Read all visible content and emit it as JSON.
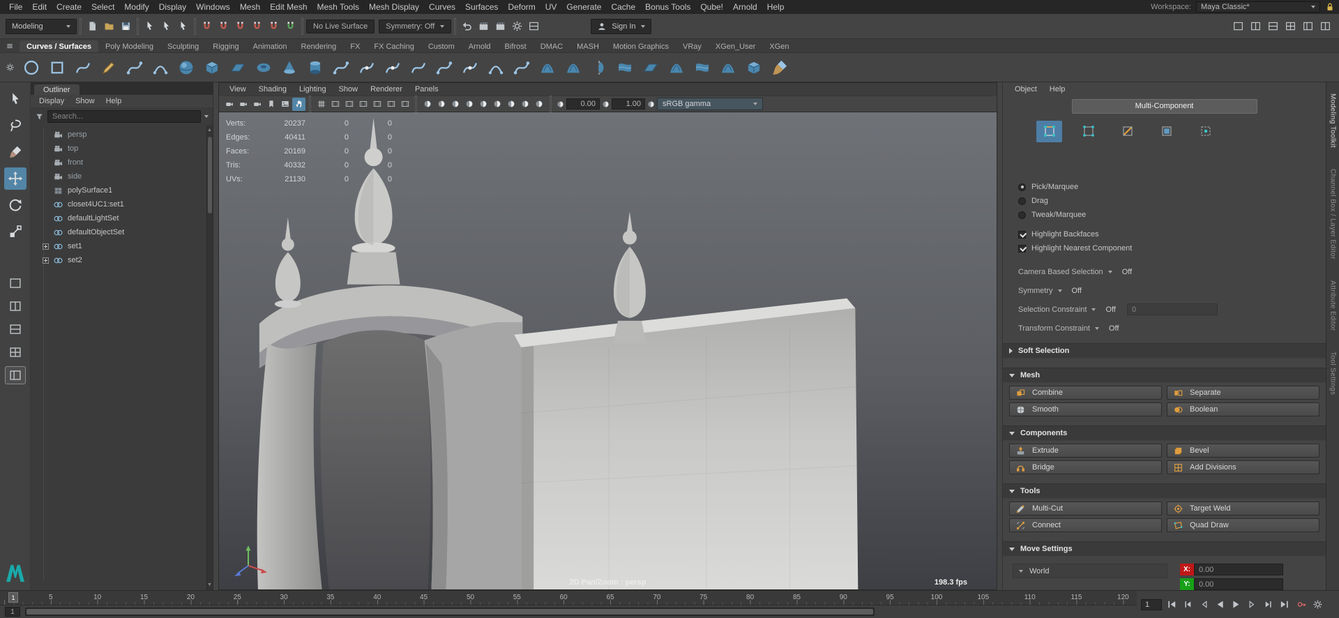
{
  "app": {
    "accent_color": "#5285a6",
    "background": "#444444"
  },
  "menubar": {
    "items": [
      "File",
      "Edit",
      "Create",
      "Select",
      "Modify",
      "Display",
      "Windows",
      "Mesh",
      "Edit Mesh",
      "Mesh Tools",
      "Mesh Display",
      "Curves",
      "Surfaces",
      "Deform",
      "UV",
      "Generate",
      "Cache",
      "Bonus Tools",
      "Qube!",
      "Arnold",
      "Help"
    ],
    "workspace_label": "Workspace:",
    "workspace_value": "Maya Classic*"
  },
  "status_line": {
    "mode_selector": "Modeling",
    "live_surface": "No Live Surface",
    "symmetry": "Symmetry: Off",
    "sign_in": "Sign In",
    "file_icons": [
      "new-scene-icon",
      "open-scene-icon",
      "save-scene-icon"
    ],
    "selection_icons": [
      "select-hierarchy-icon",
      "select-object-icon",
      "select-component-icon"
    ],
    "snap_icons": [
      "snap-grid-icon",
      "snap-curve-icon",
      "snap-point-icon",
      "snap-projected-center-icon",
      "snap-view-plane-icon",
      "make-live-icon"
    ],
    "render_icons": [
      "construction-history-icon",
      "render-frame-icon",
      "ipr-render-icon",
      "render-settings-icon",
      "display-layers-icon"
    ],
    "layout_icons": [
      "single-pane-icon",
      "two-pane-icon",
      "stacked-pane-icon",
      "four-pane-icon",
      "outliner-pane-icon",
      "script-editor-pane-icon"
    ]
  },
  "shelf": {
    "active_tab": "Curves / Surfaces",
    "tabs": [
      "Curves / Surfaces",
      "Poly Modeling",
      "Sculpting",
      "Rigging",
      "Animation",
      "Rendering",
      "FX",
      "FX Caching",
      "Custom",
      "Arnold",
      "Bifrost",
      "DMAC",
      "MASH",
      "Motion Graphics",
      "VRay",
      "XGen_User",
      "XGen"
    ],
    "icons": [
      "nurbs-circle-icon",
      "nurbs-square-icon",
      "ep-curve-tool-icon",
      "pencil-curve-tool-icon",
      "bezier-curve-tool-icon",
      "three-point-arc-icon",
      "nurbs-sphere-icon",
      "nurbs-cube-icon",
      "nurbs-plane-icon",
      "nurbs-torus-icon",
      "nurbs-cone-icon",
      "nurbs-cylinder-icon",
      "attach-curves-icon",
      "detach-curves-icon",
      "insert-knot-icon",
      "extend-curve-icon",
      "offset-curve-icon",
      "rebuild-curve-icon",
      "curve-fillet-icon",
      "intersect-curves-icon",
      "project-curve-icon",
      "trim-tool-icon",
      "revolve-icon",
      "loft-icon",
      "planar-icon",
      "extrude-surface-icon",
      "birail-icon",
      "boundary-icon",
      "nurbs-to-polygons-icon",
      "paint-effects-brush-icon"
    ]
  },
  "toolbox": {
    "tools": [
      {
        "label": "Select Tool",
        "icon": "select-cursor-icon",
        "active": false
      },
      {
        "label": "Lasso Tool",
        "icon": "lasso-icon",
        "active": false
      },
      {
        "label": "Paint Selection Tool",
        "icon": "paint-select-icon",
        "active": false
      },
      {
        "label": "Move Tool",
        "icon": "move-tool-icon",
        "active": true
      },
      {
        "label": "Rotate Tool",
        "icon": "rotate-tool-icon",
        "active": false
      },
      {
        "label": "Scale Tool",
        "icon": "scale-tool-icon",
        "active": false
      }
    ],
    "layouts": [
      {
        "icon": "single-pane-layout-icon",
        "active": false
      },
      {
        "icon": "two-pane-layout-icon",
        "active": false
      },
      {
        "icon": "stacked-pane-layout-icon",
        "active": false
      },
      {
        "icon": "four-pane-layout-icon",
        "active": false
      },
      {
        "icon": "outliner-persp-layout-icon",
        "active": true
      }
    ]
  },
  "outliner": {
    "title": "Outliner",
    "menus": [
      "Display",
      "Show",
      "Help"
    ],
    "search_placeholder": "Search...",
    "items": [
      {
        "label": "persp",
        "icon": "camera-icon",
        "dim": true,
        "expandable": false
      },
      {
        "label": "top",
        "icon": "camera-icon",
        "dim": true,
        "expandable": false
      },
      {
        "label": "front",
        "icon": "camera-icon",
        "dim": true,
        "expandable": false
      },
      {
        "label": "side",
        "icon": "camera-icon",
        "dim": true,
        "expandable": false
      },
      {
        "label": "polySurface1",
        "icon": "poly-mesh-icon",
        "dim": false,
        "expandable": false
      },
      {
        "label": "closet4UC1:set1",
        "icon": "object-set-icon",
        "dim": false,
        "expandable": false
      },
      {
        "label": "defaultLightSet",
        "icon": "light-set-icon",
        "dim": false,
        "expandable": false
      },
      {
        "label": "defaultObjectSet",
        "icon": "object-set-icon",
        "dim": false,
        "expandable": false
      },
      {
        "label": "set1",
        "icon": "object-set-icon",
        "dim": false,
        "expandable": true
      },
      {
        "label": "set2",
        "icon": "object-set-icon",
        "dim": false,
        "expandable": true
      }
    ]
  },
  "viewport": {
    "menus": [
      "View",
      "Shading",
      "Lighting",
      "Show",
      "Renderer",
      "Panels"
    ],
    "toolbar": {
      "groups": [
        [
          "select-camera-icon",
          "lock-camera-icon",
          "camera-attributes-icon",
          "bookmark-icon",
          "image-plane-icon",
          "2d-pan-zoom-icon"
        ],
        [
          "grid-toggle-icon",
          "film-gate-icon",
          "resolution-gate-icon",
          "gate-mask-icon",
          "field-chart-icon",
          "safe-action-icon",
          "safe-title-icon"
        ],
        [
          "wireframe-icon",
          "smooth-shade-icon",
          "textured-icon",
          "use-default-material-icon",
          "shadows-icon",
          "screen-space-ao-icon",
          "motion-blur-icon",
          "multisample-icon",
          "isolate-select-icon"
        ]
      ],
      "active_icon": "2d-pan-zoom-icon",
      "exposure_value": "0.00",
      "gamma_value": "1.00",
      "color_transform": "sRGB gamma"
    },
    "hud": {
      "rows": [
        {
          "label": "Verts:",
          "total": "20237",
          "sel": "0",
          "other": "0"
        },
        {
          "label": "Edges:",
          "total": "40411",
          "sel": "0",
          "other": "0"
        },
        {
          "label": "Faces:",
          "total": "20169",
          "sel": "0",
          "other": "0"
        },
        {
          "label": "Tris:",
          "total": "40332",
          "sel": "0",
          "other": "0"
        },
        {
          "label": "UVs:",
          "total": "21130",
          "sel": "0",
          "other": "0"
        }
      ]
    },
    "overlay_label": "2D Pan/Zoom : persp",
    "fps_label": "198.3 fps"
  },
  "toolkit": {
    "menus": [
      "Object",
      "Help"
    ],
    "mode_button": "Multi-Component",
    "component_icons": [
      {
        "name": "multi-component-icon",
        "active": true
      },
      {
        "name": "vertex-mode-icon",
        "active": false
      },
      {
        "name": "edge-mode-icon",
        "active": false
      },
      {
        "name": "face-mode-icon",
        "active": false
      },
      {
        "name": "uv-mode-icon",
        "active": false
      }
    ],
    "radios": [
      {
        "label": "Pick/Marquee",
        "selected": true
      },
      {
        "label": "Drag",
        "selected": false
      },
      {
        "label": "Tweak/Marquee",
        "selected": false
      }
    ],
    "checkboxes": [
      {
        "label": "Highlight Backfaces",
        "checked": true
      },
      {
        "label": "Highlight Nearest Component",
        "checked": true
      }
    ],
    "selection_options": [
      {
        "label": "Camera Based Selection",
        "value": "Off",
        "field": null
      },
      {
        "label": "Symmetry",
        "value": "Off",
        "field": null
      },
      {
        "label": "Selection Constraint",
        "value": "Off",
        "field": "0"
      },
      {
        "label": "Transform Constraint",
        "value": "Off",
        "field": null
      }
    ],
    "soft_selection_label": "Soft Selection",
    "sections": [
      {
        "title": "Mesh",
        "buttons": [
          {
            "label": "Combine",
            "icon": "combine-icon"
          },
          {
            "label": "Separate",
            "icon": "separate-icon"
          },
          {
            "label": "Smooth",
            "icon": "smooth-icon"
          },
          {
            "label": "Boolean",
            "icon": "boolean-icon"
          }
        ]
      },
      {
        "title": "Components",
        "buttons": [
          {
            "label": "Extrude",
            "icon": "extrude-icon"
          },
          {
            "label": "Bevel",
            "icon": "bevel-icon"
          },
          {
            "label": "Bridge",
            "icon": "bridge-icon"
          },
          {
            "label": "Add Divisions",
            "icon": "add-divisions-icon"
          }
        ]
      },
      {
        "title": "Tools",
        "buttons": [
          {
            "label": "Multi-Cut",
            "icon": "multi-cut-icon"
          },
          {
            "label": "Target Weld",
            "icon": "target-weld-icon"
          },
          {
            "label": "Connect",
            "icon": "connect-icon"
          },
          {
            "label": "Quad Draw",
            "icon": "quad-draw-icon"
          }
        ]
      }
    ],
    "move_settings": {
      "title": "Move Settings",
      "axis_orientation": "World",
      "x_label": "X:",
      "x_value": "0.00",
      "y_label": "Y:",
      "y_value": "0.00"
    }
  },
  "sidebar_tabs": [
    {
      "label": "Modeling Toolkit",
      "active": true
    },
    {
      "label": "Channel Box / Layer Editor",
      "active": false
    },
    {
      "label": "Attribute Editor",
      "active": false
    },
    {
      "label": "Tool Settings",
      "active": false
    }
  ],
  "timeline": {
    "ticks": [
      5,
      10,
      15,
      20,
      25,
      30,
      35,
      40,
      45,
      50,
      55,
      60,
      65,
      70,
      75,
      80,
      85,
      90,
      95,
      100,
      105,
      110,
      115,
      120
    ],
    "current_frame": "1",
    "range_start": "1",
    "current_time": "1",
    "playback_icons": [
      "go-to-start-icon",
      "step-back-frame-icon",
      "step-back-key-icon",
      "play-backwards-icon",
      "play-forwards-icon",
      "step-forward-key-icon",
      "step-forward-frame-icon",
      "go-to-end-icon"
    ],
    "extra_icons": [
      "auto-keyframe-icon",
      "anim-preferences-icon"
    ]
  }
}
